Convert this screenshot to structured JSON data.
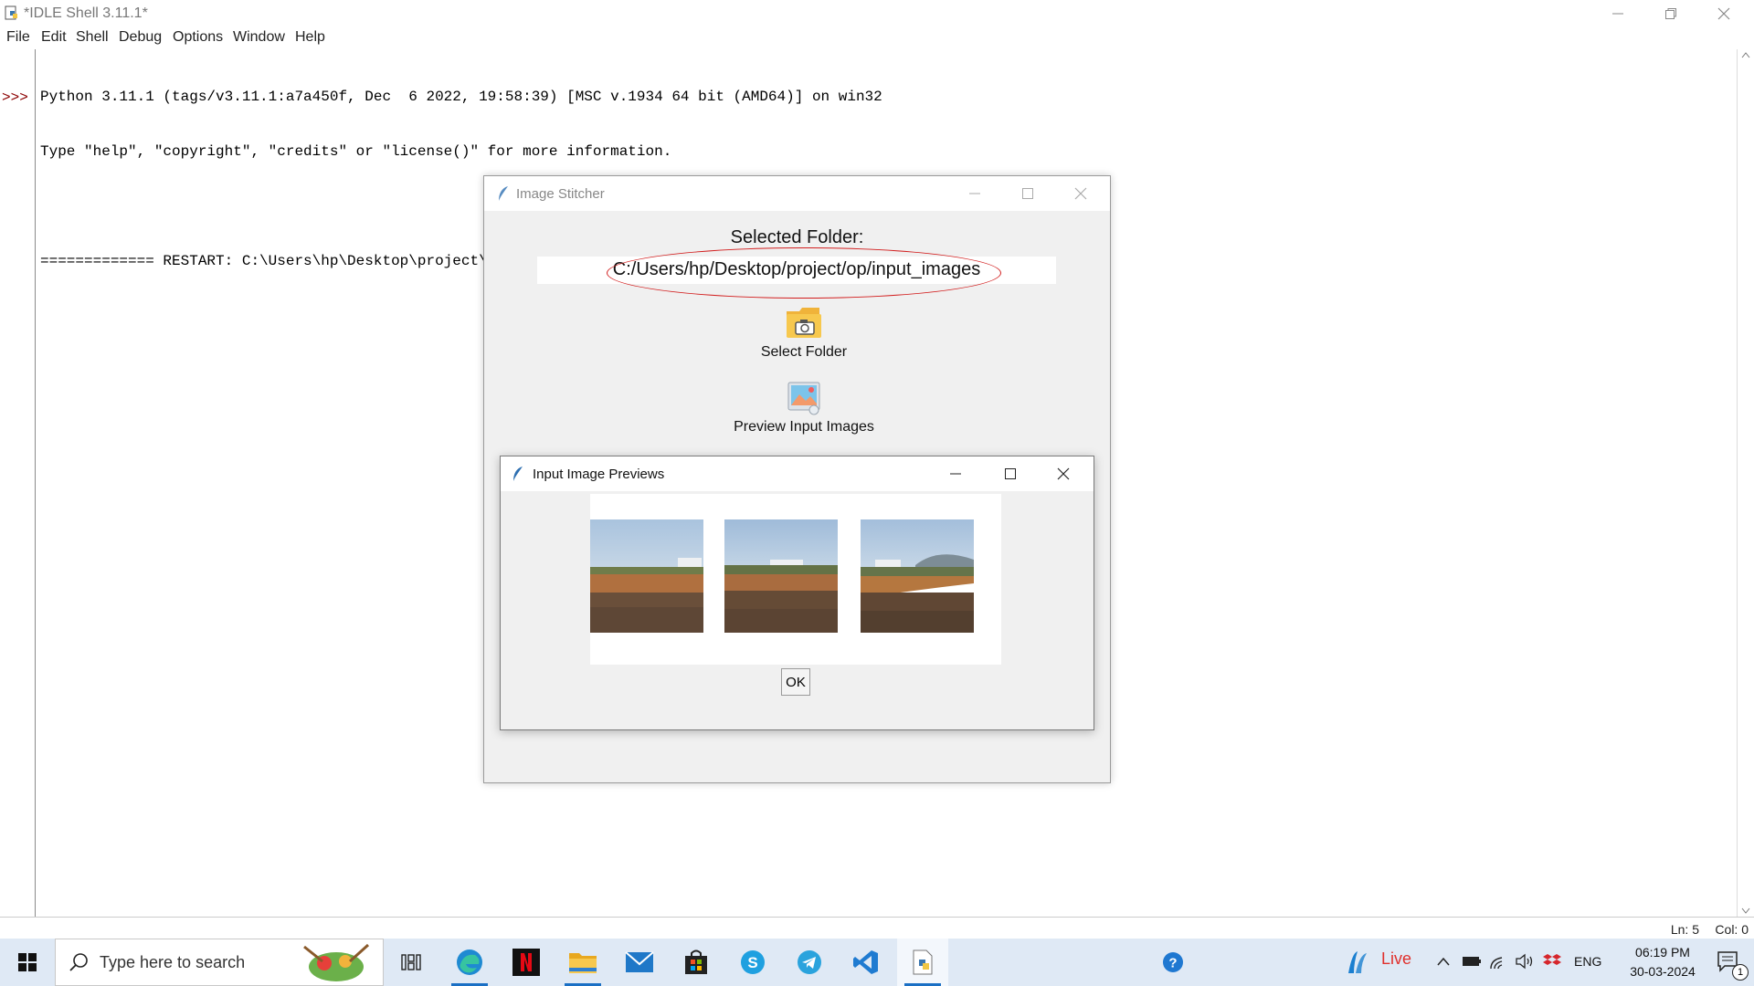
{
  "window": {
    "title": "*IDLE Shell 3.11.1*"
  },
  "menu": [
    "File",
    "Edit",
    "Shell",
    "Debug",
    "Options",
    "Window",
    "Help"
  ],
  "shell": {
    "prompt": ">>>",
    "lines": [
      "Python 3.11.1 (tags/v3.11.1:a7a450f, Dec  6 2022, 19:58:39) [MSC v.1934 64 bit (AMD64)] on win32",
      "Type \"help\", \"copyright\", \"credits\" or \"license()\" for more information.",
      "",
      "============= RESTART: C:\\Users\\hp\\Desktop\\project\\op\\icons\\MAIN.py ============"
    ]
  },
  "status": {
    "line": "Ln: 5",
    "col": "Col: 0"
  },
  "stitcher": {
    "title": "Image Stitcher",
    "selected_label": "Selected Folder:",
    "folder_path": "C:/Users/hp/Desktop/project/op/input_images",
    "select_folder_label": "Select Folder",
    "preview_label": "Preview Input Images",
    "annotation_color": "#d21e1e"
  },
  "previews": {
    "title": "Input Image Previews",
    "ok_label": "OK",
    "thumbnails": [
      "field-photo-1",
      "field-photo-2",
      "field-photo-3"
    ]
  },
  "taskbar": {
    "search_placeholder": "Type here to search",
    "apps": [
      "task-view",
      "edge",
      "netflix",
      "file-explorer",
      "mail",
      "store",
      "skype",
      "telegram",
      "vscode",
      "python-idle"
    ],
    "tray": {
      "live_label": "Live",
      "language": "ENG",
      "time": "06:19 PM",
      "date": "30-03-2024",
      "notifications": "1"
    },
    "accent": "#1a6fc4"
  }
}
